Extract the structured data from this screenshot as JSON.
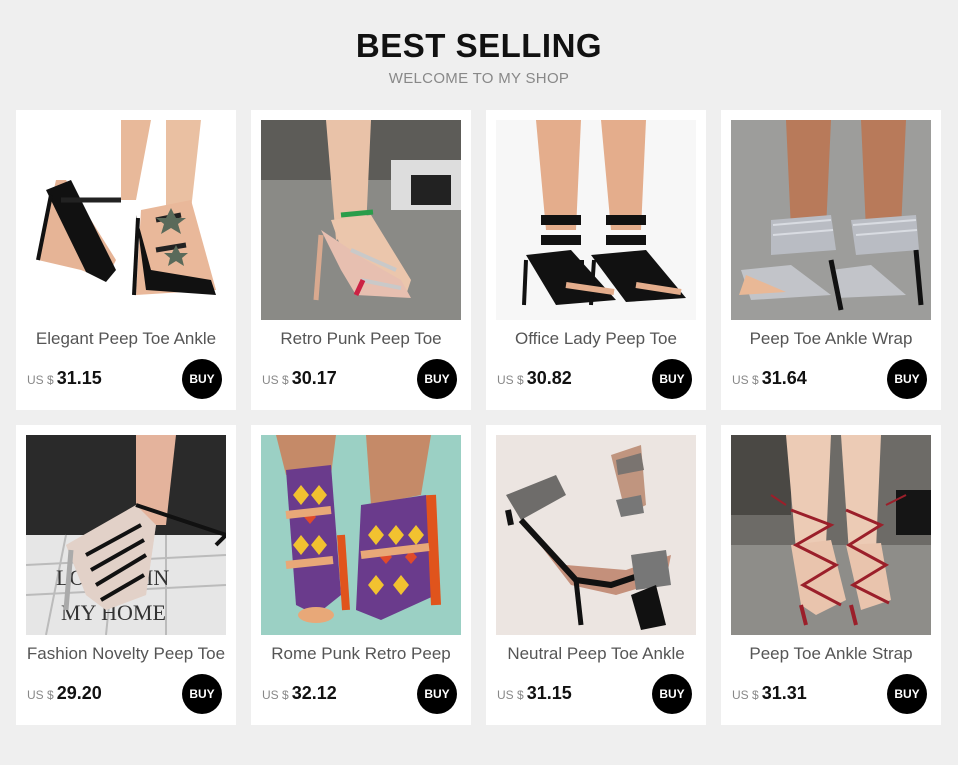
{
  "header": {
    "title": "BEST SELLING",
    "subtitle": "WELCOME TO MY SHOP"
  },
  "products": [
    {
      "name": "Elegant Peep Toe Ankle",
      "currency": "US $",
      "price": "31.15",
      "buy_label": "BUY",
      "image": "black-strappy-star-heels"
    },
    {
      "name": "Retro Punk Peep Toe",
      "currency": "US $",
      "price": "30.17",
      "buy_label": "BUY",
      "image": "nude-rhinestone-strap-heels"
    },
    {
      "name": "Office Lady Peep Toe",
      "currency": "US $",
      "price": "30.82",
      "buy_label": "BUY",
      "image": "black-buckle-strap-heels"
    },
    {
      "name": "Peep Toe Ankle Wrap",
      "currency": "US $",
      "price": "31.64",
      "buy_label": "BUY",
      "image": "glitter-ankle-wrap-heels"
    },
    {
      "name": "Fashion Novelty Peep Toe",
      "currency": "US $",
      "price": "29.20",
      "buy_label": "BUY",
      "image": "clear-lace-up-heels"
    },
    {
      "name": "Rome Punk Retro Peep",
      "currency": "US $",
      "price": "32.12",
      "buy_label": "BUY",
      "image": "aztec-print-heels"
    },
    {
      "name": "Neutral Peep Toe Ankle",
      "currency": "US $",
      "price": "31.15",
      "buy_label": "BUY",
      "image": "black-glitter-ankle-strap-heels"
    },
    {
      "name": "Peep Toe Ankle Strap",
      "currency": "US $",
      "price": "31.31",
      "buy_label": "BUY",
      "image": "red-lace-up-heels"
    }
  ],
  "colors": {
    "page_background": "#efefef",
    "card_background": "#ffffff",
    "buy_button": "#000000",
    "price_text": "#111111",
    "muted_text": "#888888"
  }
}
